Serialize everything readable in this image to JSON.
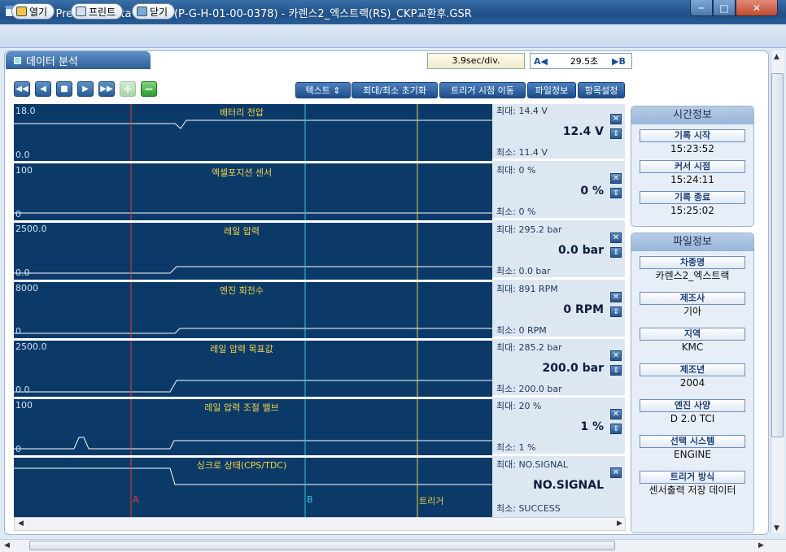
{
  "window": {
    "title": "Hi-DS Premium Data Viewer (P-G-H-01-00-0378) - 카렌스2_엑스트랙(RS)_CKP교환후.GSR",
    "min": "─",
    "max": "□",
    "close": "✕"
  },
  "toolbar": {
    "open": "열기",
    "print": "프린트",
    "close": "닫기"
  },
  "tab": {
    "label": "데이터 분석"
  },
  "timebase": "3.9sec/div.",
  "cursor": {
    "a": "A◀",
    "value": "29.5초",
    "b": "▶B"
  },
  "nav": {
    "first": "◀◀",
    "prev": "◀",
    "stop": "■",
    "next": "▶",
    "last": "▶▶",
    "plus": "+",
    "minus": "−"
  },
  "controls": {
    "text": "텍스트 ⇕",
    "reset": "최대/최소 초기화",
    "trigger": "트리거 시점 이동",
    "fileinfo": "파일정보",
    "items": "항목설정"
  },
  "channels": [
    {
      "name": "배터리 전압",
      "top": "18.0",
      "bottom": "0.0",
      "max": "최대:  14.4 V",
      "current": "12.4 V",
      "min": "최소:  11.4 V"
    },
    {
      "name": "엑셀포지션 센서",
      "top": "100",
      "bottom": "0",
      "max": "최대:     0 %",
      "current": "0 %",
      "min": "최소:     0 %"
    },
    {
      "name": "레일 압력",
      "top": "2500.0",
      "bottom": "0.0",
      "max": "최대: 295.2 bar",
      "current": "0.0 bar",
      "min": "최소:  0.0 bar"
    },
    {
      "name": "엔진 회전수",
      "top": "8000",
      "bottom": "0",
      "max": "최대:   891 RPM",
      "current": "0 RPM",
      "min": "최소:     0 RPM"
    },
    {
      "name": "레일 압력 목표값",
      "top": "2500.0",
      "bottom": "0.0",
      "max": "최대: 285.2 bar",
      "current": "200.0 bar",
      "min": "최소: 200.0 bar"
    },
    {
      "name": "레일 압력 조절 밸브",
      "top": "100",
      "bottom": "0",
      "max": "최대:    20 %",
      "current": "1 %",
      "min": "최소:    1 %"
    },
    {
      "name": "싱크로 상태(CPS/TDC)",
      "top": "",
      "bottom": "",
      "max": "최대: NO.SIGNAL",
      "current": "NO.SIGNAL",
      "min": "최소: SUCCESS"
    }
  ],
  "markers": {
    "a": "A",
    "b": "B",
    "trigger": "트리거"
  },
  "timeinfo": {
    "title": "시간정보",
    "start_label": "기록 시작",
    "start": "15:23:52",
    "cursor_label": "커서 시점",
    "cursor": "15:24:11",
    "end_label": "기록 종료",
    "end": "15:25:02"
  },
  "fileinfo": {
    "title": "파일정보",
    "model_label": "차종명",
    "model": "카렌스2_엑스트랙",
    "maker_label": "제조사",
    "maker": "기아",
    "region_label": "지역",
    "region": "KMC",
    "year_label": "제조년",
    "year": "2004",
    "engine_label": "엔진 사양",
    "engine": "D 2.0 TCI",
    "system_label": "선택 시스템",
    "system": "ENGINE",
    "trigger_label": "트리거 방식",
    "trigger": "센서출력 저장 데이터"
  },
  "colors": {
    "chart_bg": "#0b3a68",
    "label": "#f2d44a",
    "marker_a": "#e53935",
    "marker_b": "#35c6e6",
    "trigger": "#e8d24a"
  }
}
